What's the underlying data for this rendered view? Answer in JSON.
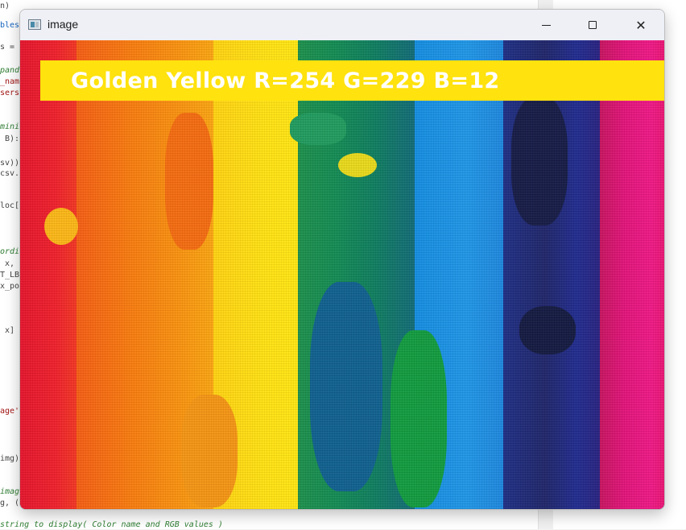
{
  "background_editor": {
    "lines": [
      {
        "text": "n)",
        "cls": "c-dim"
      },
      {
        "text": "bles",
        "cls": "c-blue"
      },
      {
        "text": "s =",
        "cls": "c-dim"
      },
      {
        "text": "pand",
        "cls": "c-green"
      },
      {
        "text": "_nam",
        "cls": "c-red"
      },
      {
        "text": "sers",
        "cls": "c-red"
      },
      {
        "text": "mini",
        "cls": "c-green"
      },
      {
        "text": " B):",
        "cls": "c-dim"
      },
      {
        "text": "sv))",
        "cls": "c-dim"
      },
      {
        "text": "csv.",
        "cls": "c-dim"
      },
      {
        "text": "loc[",
        "cls": "c-dim"
      },
      {
        "text": "ordi",
        "cls": "c-green"
      },
      {
        "text": " x,",
        "cls": "c-dim"
      },
      {
        "text": "T_LB",
        "cls": "c-dim"
      },
      {
        "text": "x_po",
        "cls": "c-dim"
      },
      {
        "text": " x]",
        "cls": "c-dim"
      },
      {
        "text": "age'",
        "cls": "c-red"
      },
      {
        "text": "img)",
        "cls": "c-dim"
      },
      {
        "text": "imag",
        "cls": "c-green"
      },
      {
        "text": "g, (",
        "cls": "c-dim"
      },
      {
        "text": "string to display( Color name and RGB values )",
        "cls": "c-green"
      }
    ]
  },
  "window": {
    "title": "image",
    "icon": "image-window-icon",
    "controls": {
      "minimize": "minimize-icon",
      "maximize": "maximize-icon",
      "close_glyph": "✕"
    }
  },
  "canvas": {
    "banner_color": "#ffe20e",
    "banner_text": "Golden Yellow R=254 G=229 B=12",
    "stripe_colors": [
      "#ef1f2a",
      "#f8780d",
      "#ffe111",
      "#128a52",
      "#1e95e6",
      "#1e2468",
      "#e2127a"
    ]
  }
}
